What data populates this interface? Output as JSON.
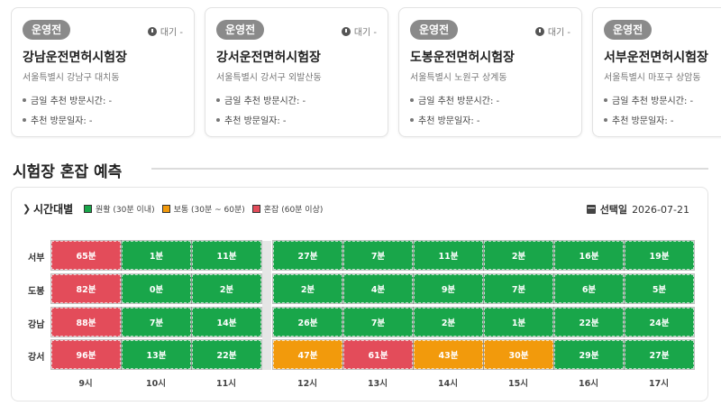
{
  "cards": [
    {
      "badge": "운영전",
      "status": "대기 -",
      "title": "강남운전면허시험장",
      "address": "서울특별시 강남구 대치동",
      "visit_time_label": "금일 추천 방문시간: -",
      "visit_date_label": "추천 방문일자: -"
    },
    {
      "badge": "운영전",
      "status": "대기 -",
      "title": "강서운전면허시험장",
      "address": "서울특별시 강서구 외발산동",
      "visit_time_label": "금일 추천 방문시간: -",
      "visit_date_label": "추천 방문일자: -"
    },
    {
      "badge": "운영전",
      "status": "대기 -",
      "title": "도봉운전면허시험장",
      "address": "서울특별시 노원구 상계동",
      "visit_time_label": "금일 추천 방문시간: -",
      "visit_date_label": "추천 방문일자: -"
    },
    {
      "badge": "운영전",
      "status": "",
      "title": "서부운전면허시험장",
      "address": "서울특별시 마포구 상암동",
      "visit_time_label": "금일 추천 방문시간: -",
      "visit_date_label": "추천 방문일자: -"
    }
  ],
  "section_title": "시험장 혼잡 예측",
  "panel": {
    "view_label": "시간대별",
    "legend": [
      {
        "label": "원활 (30분 이내)",
        "color": "#19a64a"
      },
      {
        "label": "보통 (30분 ~ 60분)",
        "color": "#f29a0c"
      },
      {
        "label": "혼잡 (60분 이상)",
        "color": "#e34c5a"
      }
    ],
    "date_label": "선택일",
    "date_value": "2026-07-21"
  },
  "colors": {
    "green": "#19a64a",
    "orange": "#f29a0c",
    "red": "#e34c5a"
  },
  "hours": [
    "9시",
    "10시",
    "11시",
    "12시",
    "13시",
    "14시",
    "15시",
    "16시",
    "17시"
  ],
  "rows": [
    {
      "label": "서부",
      "cells": [
        {
          "text": "65분",
          "level": "red"
        },
        {
          "text": "1분",
          "level": "green"
        },
        {
          "text": "11분",
          "level": "green"
        },
        {
          "text": "27분",
          "level": "green"
        },
        {
          "text": "7분",
          "level": "green"
        },
        {
          "text": "11분",
          "level": "green"
        },
        {
          "text": "2분",
          "level": "green"
        },
        {
          "text": "16분",
          "level": "green"
        },
        {
          "text": "19분",
          "level": "green"
        }
      ]
    },
    {
      "label": "도봉",
      "cells": [
        {
          "text": "82분",
          "level": "red"
        },
        {
          "text": "0분",
          "level": "green"
        },
        {
          "text": "2분",
          "level": "green"
        },
        {
          "text": "2분",
          "level": "green"
        },
        {
          "text": "4분",
          "level": "green"
        },
        {
          "text": "9분",
          "level": "green"
        },
        {
          "text": "7분",
          "level": "green"
        },
        {
          "text": "6분",
          "level": "green"
        },
        {
          "text": "5분",
          "level": "green"
        }
      ]
    },
    {
      "label": "강남",
      "cells": [
        {
          "text": "88분",
          "level": "red"
        },
        {
          "text": "7분",
          "level": "green"
        },
        {
          "text": "14분",
          "level": "green"
        },
        {
          "text": "26분",
          "level": "green"
        },
        {
          "text": "7분",
          "level": "green"
        },
        {
          "text": "2분",
          "level": "green"
        },
        {
          "text": "1분",
          "level": "green"
        },
        {
          "text": "22분",
          "level": "green"
        },
        {
          "text": "24분",
          "level": "green"
        }
      ]
    },
    {
      "label": "강서",
      "cells": [
        {
          "text": "96분",
          "level": "red"
        },
        {
          "text": "13분",
          "level": "green"
        },
        {
          "text": "22분",
          "level": "green"
        },
        {
          "text": "47분",
          "level": "orange"
        },
        {
          "text": "61분",
          "level": "red"
        },
        {
          "text": "43분",
          "level": "orange"
        },
        {
          "text": "30분",
          "level": "orange"
        },
        {
          "text": "29분",
          "level": "green"
        },
        {
          "text": "27분",
          "level": "green"
        }
      ]
    }
  ]
}
